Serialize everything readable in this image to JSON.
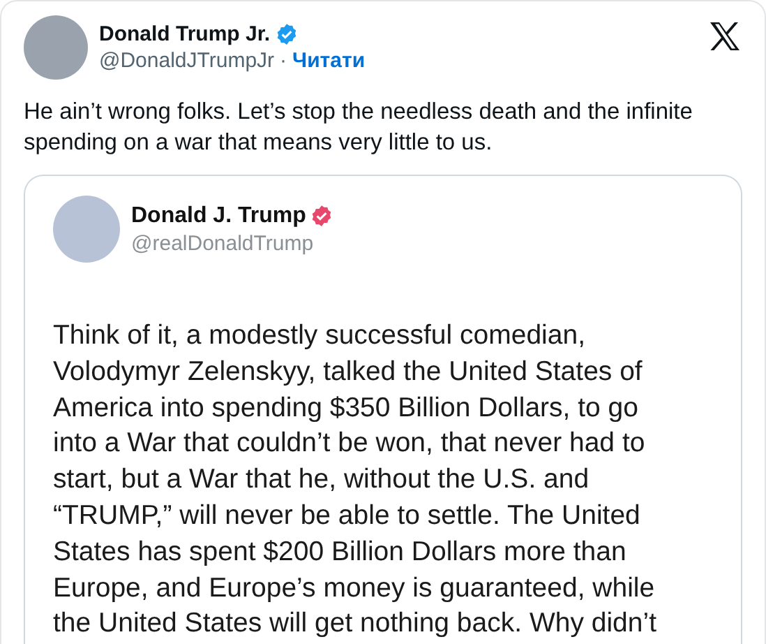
{
  "author": {
    "name": "Donald Trump Jr.",
    "verified": true,
    "handle": "@DonaldJTrumpJr",
    "separator": "·",
    "follow": "Читати"
  },
  "text": "He ain’t wrong folks. Let’s stop the needless death and the infinite spending on a war that means very little to us.",
  "quoted": {
    "name": "Donald J. Trump",
    "verified": true,
    "handle": "@realDonaldTrump",
    "lines": [
      "Think of it, a modestly successful comedian,",
      "Volodymyr Zelenskyy, talked the United States of",
      "America into spending $350 Billion Dollars, to go",
      "into a War that couldn’t be won, that never had to",
      "start, but a War that he, without the U.S. and",
      "“TRUMP,” will never be able to settle. The United",
      "States has spent $200 Billion Dollars more than",
      "Europe, and Europe’s money is guaranteed, while",
      "the United States will get nothing back. Why didn’t"
    ]
  }
}
